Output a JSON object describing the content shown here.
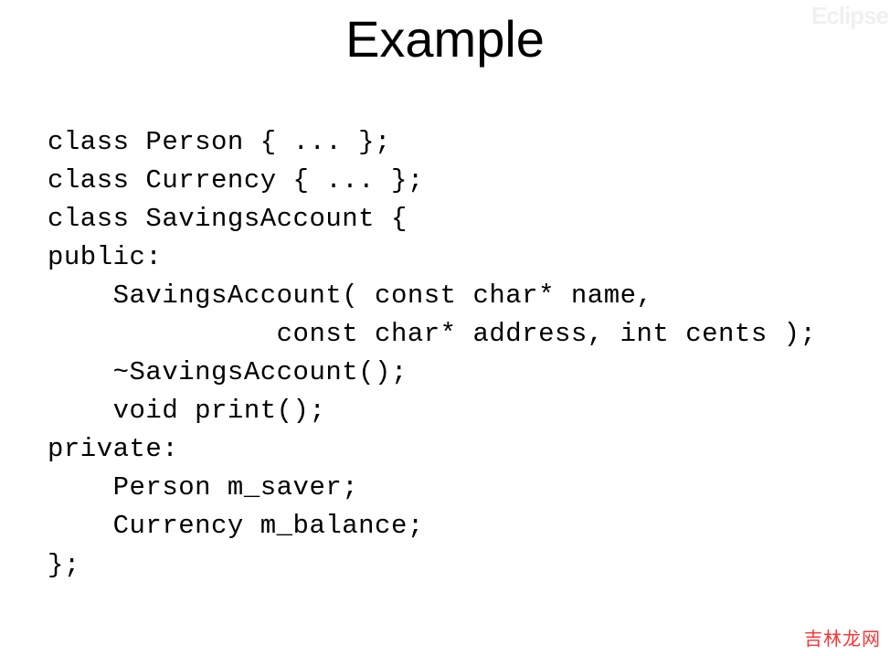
{
  "title": "Example",
  "code": {
    "line1": "class Person { ... };",
    "line2": "class Currency { ... };",
    "line3": "class SavingsAccount {",
    "line4": "public:",
    "line5": "    SavingsAccount( const char* name,",
    "line6": "              const char* address, int cents );",
    "line7": "    ~SavingsAccount();",
    "line8": "    void print();",
    "line9": "private:",
    "line10": "    Person m_saver;",
    "line11": "    Currency m_balance;",
    "line12": "};"
  },
  "watermark_top": "Eclipse",
  "watermark_bottom": "吉林龙网"
}
